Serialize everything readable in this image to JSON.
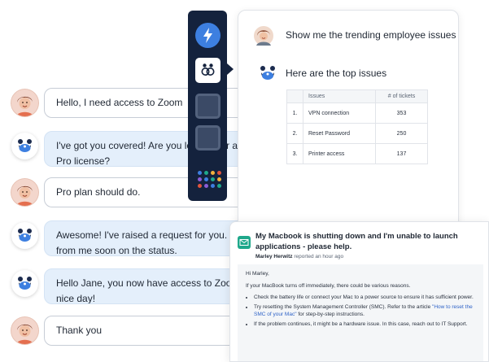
{
  "chat": {
    "messages": [
      {
        "from": "user",
        "text": "Hello, I need access to Zoom"
      },
      {
        "from": "bot",
        "line1": "I've got you covered! Are you looking for a basic",
        "line2": "Pro license?"
      },
      {
        "from": "user",
        "text": "Pro plan should do."
      },
      {
        "from": "bot",
        "line1": "Awesome! I've raised a request for you. You will hear",
        "line2": "from me soon on the status."
      },
      {
        "from": "bot",
        "line1": "Hello Jane, you now have access to Zoom. Have a",
        "line2": "nice day!"
      },
      {
        "from": "user",
        "text": "Thank you"
      }
    ]
  },
  "rail": {
    "items": [
      "bolt-app-icon",
      "assistant-app-icon",
      "app-placeholder-1",
      "app-placeholder-2"
    ],
    "dot_colors": [
      "#3d7fe0",
      "#1fa88b",
      "#f2b13d",
      "#e0533d",
      "#8a5cd6",
      "#3d7fe0",
      "#1fa88b",
      "#f2b13d",
      "#e0533d",
      "#8a5cd6",
      "#3d7fe0",
      "#1fa88b"
    ]
  },
  "panel": {
    "question": "Show me the trending employee issues",
    "answer": "Here are the top issues",
    "table": {
      "headers": [
        "",
        "Issues",
        "# of tickets"
      ],
      "rows": [
        {
          "n": "1.",
          "issue": "VPN connection",
          "tickets": "353"
        },
        {
          "n": "2.",
          "issue": "Reset Password",
          "tickets": "250"
        },
        {
          "n": "3.",
          "issue": "Printer access",
          "tickets": "137"
        }
      ]
    }
  },
  "email": {
    "title": "My Macbook is shutting down and I'm unable to launch applications - please help.",
    "author": "Marley Herwitz",
    "time": "reported an hour ago",
    "greeting": "Hi Marley,",
    "intro": "If your MacBook turns off immediately, there could be various reasons.",
    "bullet1": "Check the battery life or connect your Mac to a power source to ensure it has sufficient power.",
    "bullet2_pre": "Try resetting the System Management Controller (SMC). Refer to the article ",
    "bullet2_link": "\"How to reset the SMC of your Mac\"",
    "bullet2_post": " for step-by-step instructions.",
    "bullet3": "If the problem continues, it might be a hardware issue. In this case, reach out to IT Support."
  },
  "colors": {
    "rail_bg": "#14223d",
    "bot_bubble": "#e4effb",
    "accent_blue": "#3d7fe0",
    "mail_green": "#1fa88b",
    "link": "#2f63c7"
  }
}
